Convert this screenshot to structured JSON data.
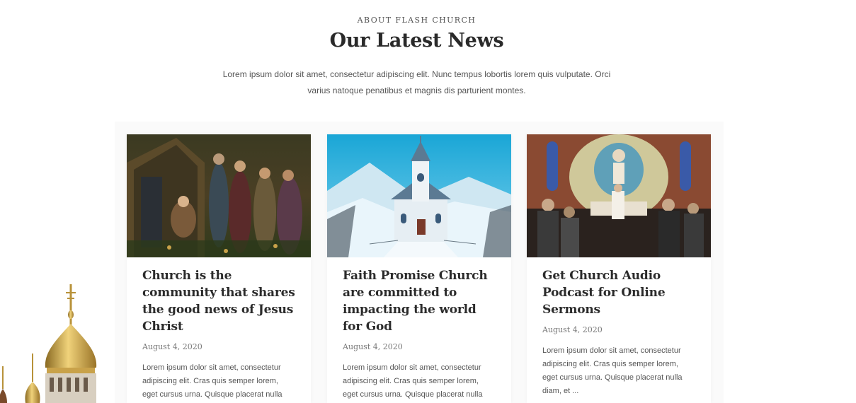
{
  "section": {
    "eyebrow": "ABOUT FLASH CHURCH",
    "title": "Our Latest News",
    "intro": "Lorem ipsum dolor sit amet, consectetur adipiscing elit. Nunc tempus lobortis lorem quis vulputate. Orci varius natoque penatibus et magnis dis parturient montes."
  },
  "posts": [
    {
      "title": "Church is the community that shares the good news of Jesus Christ",
      "date": "August 4, 2020",
      "excerpt": "Lorem ipsum dolor sit amet, consectetur adipiscing elit. Cras quis semper lorem, eget cursus urna. Quisque placerat nulla diam, et ..."
    },
    {
      "title": "Faith Promise Church are committed to impacting the world for God",
      "date": "August 4, 2020",
      "excerpt": "Lorem ipsum dolor sit amet, consectetur adipiscing elit. Cras quis semper lorem, eget cursus urna. Quisque placerat nulla diam, et ..."
    },
    {
      "title": "Get Church Audio Podcast for Online Sermons",
      "date": "August 4, 2020",
      "excerpt": "Lorem ipsum dolor sit amet, consectetur adipiscing elit. Cras quis semper lorem, eget cursus urna. Quisque placerat nulla diam, et ..."
    }
  ],
  "colors": {
    "heading": "#2a2a2a",
    "text": "#555555",
    "background": "#ffffff"
  }
}
